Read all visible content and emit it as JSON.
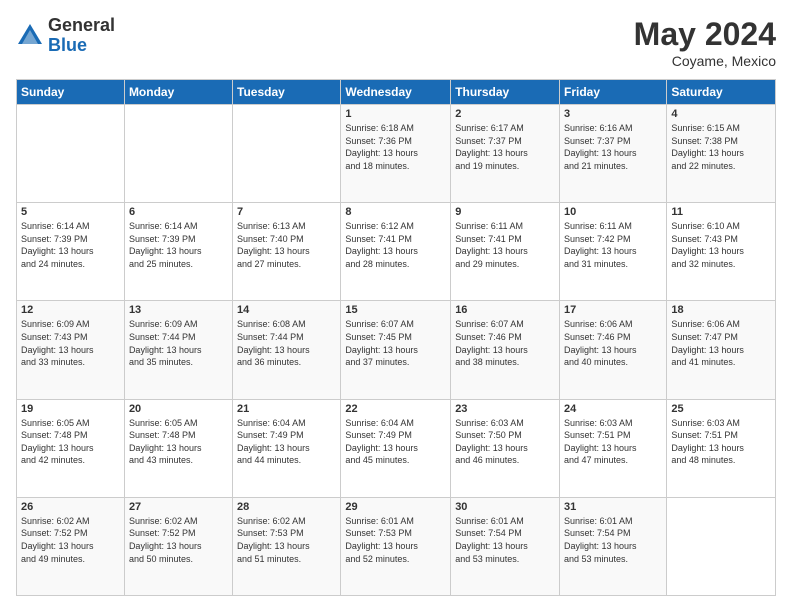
{
  "logo": {
    "general": "General",
    "blue": "Blue"
  },
  "title": {
    "month_year": "May 2024",
    "location": "Coyame, Mexico"
  },
  "calendar": {
    "headers": [
      "Sunday",
      "Monday",
      "Tuesday",
      "Wednesday",
      "Thursday",
      "Friday",
      "Saturday"
    ],
    "weeks": [
      [
        {
          "day": "",
          "info": ""
        },
        {
          "day": "",
          "info": ""
        },
        {
          "day": "",
          "info": ""
        },
        {
          "day": "1",
          "info": "Sunrise: 6:18 AM\nSunset: 7:36 PM\nDaylight: 13 hours\nand 18 minutes."
        },
        {
          "day": "2",
          "info": "Sunrise: 6:17 AM\nSunset: 7:37 PM\nDaylight: 13 hours\nand 19 minutes."
        },
        {
          "day": "3",
          "info": "Sunrise: 6:16 AM\nSunset: 7:37 PM\nDaylight: 13 hours\nand 21 minutes."
        },
        {
          "day": "4",
          "info": "Sunrise: 6:15 AM\nSunset: 7:38 PM\nDaylight: 13 hours\nand 22 minutes."
        }
      ],
      [
        {
          "day": "5",
          "info": "Sunrise: 6:14 AM\nSunset: 7:39 PM\nDaylight: 13 hours\nand 24 minutes."
        },
        {
          "day": "6",
          "info": "Sunrise: 6:14 AM\nSunset: 7:39 PM\nDaylight: 13 hours\nand 25 minutes."
        },
        {
          "day": "7",
          "info": "Sunrise: 6:13 AM\nSunset: 7:40 PM\nDaylight: 13 hours\nand 27 minutes."
        },
        {
          "day": "8",
          "info": "Sunrise: 6:12 AM\nSunset: 7:41 PM\nDaylight: 13 hours\nand 28 minutes."
        },
        {
          "day": "9",
          "info": "Sunrise: 6:11 AM\nSunset: 7:41 PM\nDaylight: 13 hours\nand 29 minutes."
        },
        {
          "day": "10",
          "info": "Sunrise: 6:11 AM\nSunset: 7:42 PM\nDaylight: 13 hours\nand 31 minutes."
        },
        {
          "day": "11",
          "info": "Sunrise: 6:10 AM\nSunset: 7:43 PM\nDaylight: 13 hours\nand 32 minutes."
        }
      ],
      [
        {
          "day": "12",
          "info": "Sunrise: 6:09 AM\nSunset: 7:43 PM\nDaylight: 13 hours\nand 33 minutes."
        },
        {
          "day": "13",
          "info": "Sunrise: 6:09 AM\nSunset: 7:44 PM\nDaylight: 13 hours\nand 35 minutes."
        },
        {
          "day": "14",
          "info": "Sunrise: 6:08 AM\nSunset: 7:44 PM\nDaylight: 13 hours\nand 36 minutes."
        },
        {
          "day": "15",
          "info": "Sunrise: 6:07 AM\nSunset: 7:45 PM\nDaylight: 13 hours\nand 37 minutes."
        },
        {
          "day": "16",
          "info": "Sunrise: 6:07 AM\nSunset: 7:46 PM\nDaylight: 13 hours\nand 38 minutes."
        },
        {
          "day": "17",
          "info": "Sunrise: 6:06 AM\nSunset: 7:46 PM\nDaylight: 13 hours\nand 40 minutes."
        },
        {
          "day": "18",
          "info": "Sunrise: 6:06 AM\nSunset: 7:47 PM\nDaylight: 13 hours\nand 41 minutes."
        }
      ],
      [
        {
          "day": "19",
          "info": "Sunrise: 6:05 AM\nSunset: 7:48 PM\nDaylight: 13 hours\nand 42 minutes."
        },
        {
          "day": "20",
          "info": "Sunrise: 6:05 AM\nSunset: 7:48 PM\nDaylight: 13 hours\nand 43 minutes."
        },
        {
          "day": "21",
          "info": "Sunrise: 6:04 AM\nSunset: 7:49 PM\nDaylight: 13 hours\nand 44 minutes."
        },
        {
          "day": "22",
          "info": "Sunrise: 6:04 AM\nSunset: 7:49 PM\nDaylight: 13 hours\nand 45 minutes."
        },
        {
          "day": "23",
          "info": "Sunrise: 6:03 AM\nSunset: 7:50 PM\nDaylight: 13 hours\nand 46 minutes."
        },
        {
          "day": "24",
          "info": "Sunrise: 6:03 AM\nSunset: 7:51 PM\nDaylight: 13 hours\nand 47 minutes."
        },
        {
          "day": "25",
          "info": "Sunrise: 6:03 AM\nSunset: 7:51 PM\nDaylight: 13 hours\nand 48 minutes."
        }
      ],
      [
        {
          "day": "26",
          "info": "Sunrise: 6:02 AM\nSunset: 7:52 PM\nDaylight: 13 hours\nand 49 minutes."
        },
        {
          "day": "27",
          "info": "Sunrise: 6:02 AM\nSunset: 7:52 PM\nDaylight: 13 hours\nand 50 minutes."
        },
        {
          "day": "28",
          "info": "Sunrise: 6:02 AM\nSunset: 7:53 PM\nDaylight: 13 hours\nand 51 minutes."
        },
        {
          "day": "29",
          "info": "Sunrise: 6:01 AM\nSunset: 7:53 PM\nDaylight: 13 hours\nand 52 minutes."
        },
        {
          "day": "30",
          "info": "Sunrise: 6:01 AM\nSunset: 7:54 PM\nDaylight: 13 hours\nand 53 minutes."
        },
        {
          "day": "31",
          "info": "Sunrise: 6:01 AM\nSunset: 7:54 PM\nDaylight: 13 hours\nand 53 minutes."
        },
        {
          "day": "",
          "info": ""
        }
      ]
    ]
  }
}
